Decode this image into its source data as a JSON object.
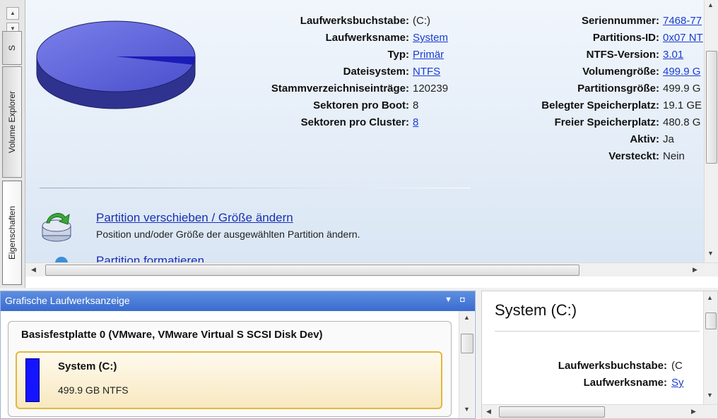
{
  "side_tabs": [
    {
      "label": "S"
    },
    {
      "label": "Volume Explorer"
    },
    {
      "label": "Eigenschaften"
    }
  ],
  "properties": {
    "left": [
      {
        "label": "Laufwerksbuchstabe:",
        "value": "(C:)",
        "link": false
      },
      {
        "label": "Laufwerksname:",
        "value": "System",
        "link": true
      },
      {
        "label": "Typ:",
        "value": "Primär",
        "link": true
      },
      {
        "label": "Dateisystem:",
        "value": "NTFS",
        "link": true
      },
      {
        "label": "Stammverzeichniseinträge:",
        "value": "120239",
        "link": false
      },
      {
        "label": "Sektoren pro Boot:",
        "value": "8",
        "link": false
      },
      {
        "label": "Sektoren pro Cluster:",
        "value": "8",
        "link": true
      }
    ],
    "right": [
      {
        "label": "Seriennummer:",
        "value": "7468-77",
        "link": true
      },
      {
        "label": "Partitions-ID:",
        "value": "0x07 NT",
        "link": true
      },
      {
        "label": "NTFS-Version:",
        "value": "3.01",
        "link": true
      },
      {
        "label": "Volumengröße:",
        "value": "499.9 G",
        "link": true
      },
      {
        "label": "Partitionsgröße:",
        "value": "499.9 G",
        "link": false
      },
      {
        "label": "Belegter Speicherplatz:",
        "value": "19.1 GE",
        "link": false
      },
      {
        "label": "Freier Speicherplatz:",
        "value": "480.8 G",
        "link": false
      },
      {
        "label": "Aktiv:",
        "value": "Ja",
        "link": false
      },
      {
        "label": "Versteckt:",
        "value": "Nein",
        "link": false
      }
    ]
  },
  "usage": {
    "used_fraction": 0.038
  },
  "colors": {
    "pie_fill": "#5a5fd6",
    "pie_used": "#1b1bb8",
    "partition_bar": "#1414ff",
    "header_blue": "#3a6bd0",
    "link": "#1a3dd0"
  },
  "tasks": [
    {
      "title": "Partition verschieben / Größe ändern",
      "description": "Position und/oder Größe der ausgewählten Partition ändern.",
      "icon": "move-resize-icon"
    },
    {
      "title": "Partition formatieren",
      "icon": "format-icon"
    }
  ],
  "graphic_view": {
    "title": "Grafische Laufwerksanzeige",
    "disk_title": "Basisfestplatte 0 (VMware, VMware Virtual S SCSI Disk Dev)",
    "partition_name": "System (C:)",
    "partition_size": "499.9 GB NTFS"
  },
  "details": {
    "title": "System (C:)",
    "rows": [
      {
        "label": "Laufwerksbuchstabe:",
        "value": "(C",
        "link": false
      },
      {
        "label": "Laufwerksname:",
        "value": "Sy",
        "link": true
      }
    ]
  }
}
